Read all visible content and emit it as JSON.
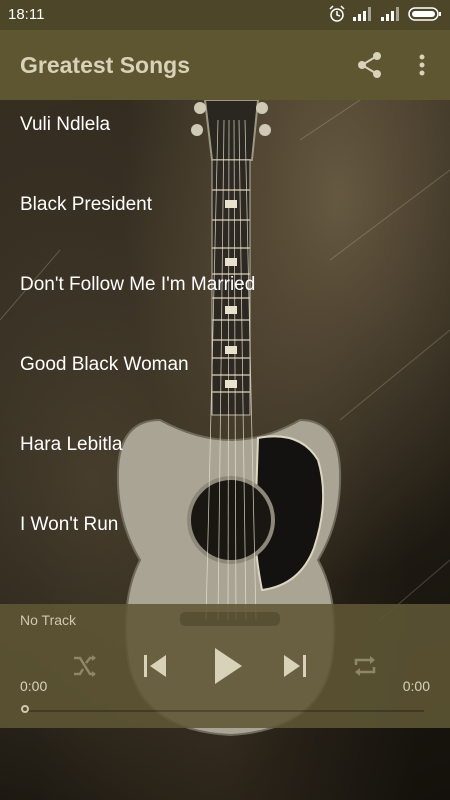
{
  "status": {
    "time": "18:11"
  },
  "appbar": {
    "title": "Greatest Songs"
  },
  "songs": [
    {
      "title": "Vuli Ndlela"
    },
    {
      "title": "Black President"
    },
    {
      "title": "Don't Follow Me I'm Married"
    },
    {
      "title": "Good Black Woman"
    },
    {
      "title": "Hara Lebitla"
    },
    {
      "title": "I Won't Run"
    }
  ],
  "player": {
    "track": "No Track",
    "elapsed": "0:00",
    "duration": "0:00",
    "progress": 0
  },
  "colors": {
    "statusbar": "#4e4629",
    "appbar": "#5e5531",
    "title_text": "#d8d2b8",
    "player_bg": "#5e5634"
  },
  "icons": [
    "alarm-icon",
    "signal-icon",
    "signal-icon-2",
    "battery-icon",
    "share-icon",
    "overflow-menu-icon",
    "shuffle-icon",
    "skip-previous-icon",
    "play-icon",
    "skip-next-icon",
    "repeat-icon"
  ]
}
